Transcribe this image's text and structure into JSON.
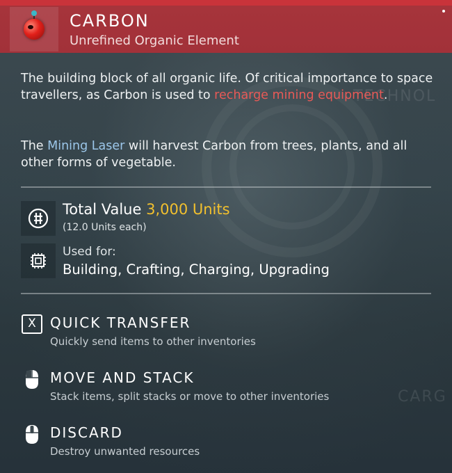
{
  "item": {
    "name": "CARBON",
    "category": "Unrefined Organic Element"
  },
  "description": {
    "p1_text": "The building block of all organic life. Of critical importance to space travellers, as Carbon is used to ",
    "p1_highlight": "recharge mining equipment",
    "p1_end": ".",
    "p2_start": "The ",
    "p2_highlight": "Mining Laser",
    "p2_text": " will harvest Carbon from trees, plants, and all other forms of vegetable."
  },
  "value": {
    "label": "Total Value",
    "amount": "3,000 Units",
    "each": "(12.0 Units each)"
  },
  "usage": {
    "label": "Used for:",
    "list": "Building, Crafting, Charging, Upgrading"
  },
  "actions": [
    {
      "key": "X",
      "title": "QUICK TRANSFER",
      "desc": "Quickly send items to other inventories",
      "icon": "x-key-icon"
    },
    {
      "title": "MOVE AND STACK",
      "desc": "Stack items, split stacks or move to other inventories",
      "icon": "mouse-left-icon"
    },
    {
      "title": "DISCARD",
      "desc": "Destroy unwanted resources",
      "icon": "mouse-middle-icon"
    }
  ],
  "background_labels": {
    "tech": "TECHNOL",
    "cargo": "CARG"
  },
  "colors": {
    "header": "#a6343b",
    "highlight_red": "#e85a57",
    "highlight_blue": "#9cc7ea",
    "gold": "#f2c02e"
  }
}
